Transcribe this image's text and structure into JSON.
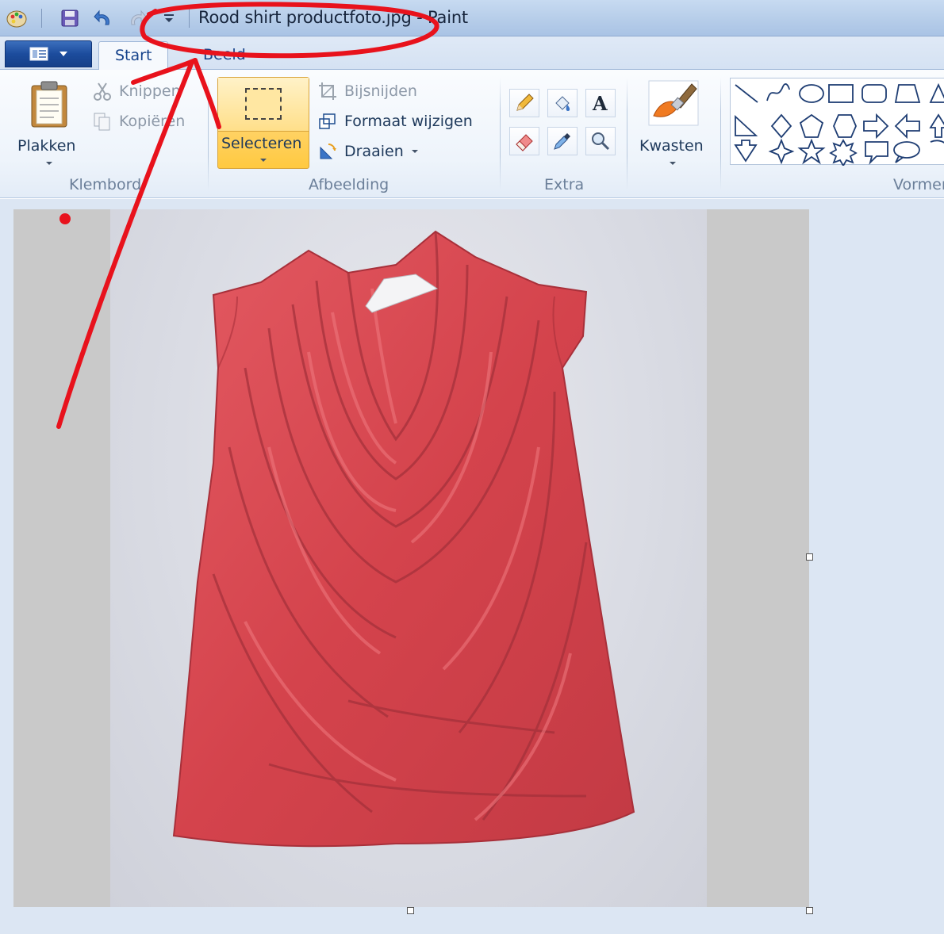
{
  "window": {
    "title": "Rood shirt productfoto.jpg - Paint"
  },
  "tabs": {
    "start": "Start",
    "view": "Beeld"
  },
  "ribbon": {
    "clipboard": {
      "label": "Klembord",
      "paste": "Plakken",
      "cut": "Knippen",
      "copy": "Kopiëren"
    },
    "image": {
      "label": "Afbeelding",
      "select": "Selecteren",
      "crop": "Bijsnijden",
      "resize": "Formaat wijzigen",
      "rotate": "Draaien"
    },
    "tools": {
      "label": "Extra"
    },
    "brushes": {
      "label": "Kwasten"
    },
    "shapes": {
      "label": "Vormen"
    }
  },
  "colors": {
    "annotation": "#e8121c",
    "shirt": "#d8484f",
    "canvas_background": "#c9c9c9",
    "selected_button": "#ffd46b"
  },
  "icons": [
    "paint-app-icon",
    "save-icon",
    "undo-icon",
    "redo-icon",
    "customize-qat-icon",
    "paste-icon",
    "cut-icon",
    "copy-icon",
    "crop-icon",
    "resize-icon",
    "rotate-icon",
    "pencil-icon",
    "fill-icon",
    "text-icon",
    "eraser-icon",
    "color-picker-icon",
    "magnifier-icon",
    "brush-icon"
  ]
}
